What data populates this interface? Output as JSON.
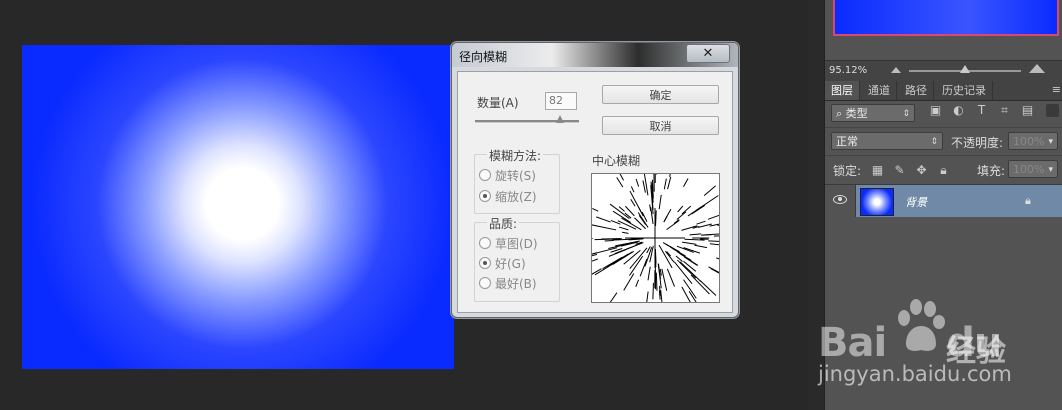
{
  "dialog": {
    "title": "径向模糊",
    "close_label": "✕",
    "amount_label": "数量(A)",
    "amount_value": "82",
    "amount_max": 100,
    "ok_label": "确定",
    "cancel_label": "取消",
    "blur_method": {
      "label": "模糊方法:",
      "options": [
        {
          "label": "旋转(S)",
          "selected": false
        },
        {
          "label": "缩放(Z)",
          "selected": true
        }
      ]
    },
    "quality": {
      "label": "品质:",
      "options": [
        {
          "label": "草图(D)",
          "selected": false
        },
        {
          "label": "好(G)",
          "selected": true
        },
        {
          "label": "最好(B)",
          "selected": false
        }
      ]
    },
    "blur_center_label": "中心模糊"
  },
  "navigator": {
    "zoom_text": "95.12%",
    "zoom_level": 0.5
  },
  "layers_panel": {
    "tabs": [
      "图层",
      "通道",
      "路径",
      "历史记录"
    ],
    "active_tab": "图层",
    "menu_icon": "≡",
    "filter_kind": "类型",
    "blend_mode": "正常",
    "opacity_label": "不透明度:",
    "opacity_value": "100%",
    "lock_label": "锁定:",
    "fill_label": "填充:",
    "fill_value": "100%",
    "layer": {
      "name": "背景",
      "visible": true,
      "locked": true
    }
  },
  "colors": {
    "canvas_blue": "#0a2bff",
    "highlight_white": "#ffffff",
    "selected_layer": "#6f89a6",
    "panel_bg": "#535353"
  },
  "watermark": {
    "logo_left": "Bai",
    "logo_right": "du",
    "logo_cn": "经验",
    "url": "jingyan.baidu.com"
  }
}
